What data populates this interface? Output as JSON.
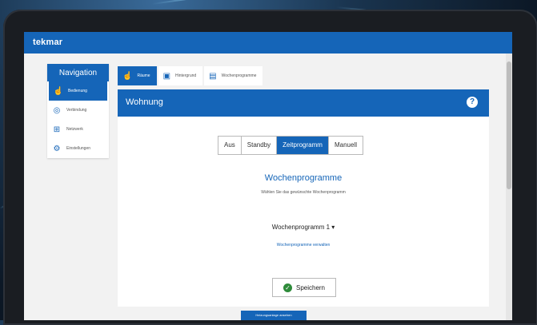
{
  "app": {
    "logo": "tekmar"
  },
  "nav": {
    "title": "Navigation",
    "items": [
      {
        "label": "Bedienung",
        "icon": "hand-pointer-icon",
        "active": true
      },
      {
        "label": "Verbindung",
        "icon": "globe-icon",
        "active": false
      },
      {
        "label": "Netzwerk",
        "icon": "sitemap-icon",
        "active": false
      },
      {
        "label": "Einstellungen",
        "icon": "gear-icon",
        "active": false
      }
    ]
  },
  "tabs": [
    {
      "label": "Räume",
      "icon": "hand-pointer-icon",
      "active": true
    },
    {
      "label": "Hintergrund",
      "icon": "briefcase-icon",
      "active": false
    },
    {
      "label": "Wochenprogramme",
      "icon": "calendar-icon",
      "active": false
    }
  ],
  "panel": {
    "title": "Wohnung",
    "modes": [
      "Aus",
      "Standby",
      "Zeitprogramm",
      "Manuell"
    ],
    "active_mode": "Zeitprogramm",
    "section_title": "Wochenprogramme",
    "section_subtitle": "Wählen Sie das gewünschte Wochenprogramm",
    "program_select": "Wochenprogramm 1 ▾",
    "program_link": "Wochenprogramme verwalten",
    "save_label": "Speichern"
  },
  "footer": {
    "button_label": "Heizungsanlage ansehen"
  },
  "colors": {
    "accent": "#1565b8",
    "success": "#2e8b3a"
  }
}
